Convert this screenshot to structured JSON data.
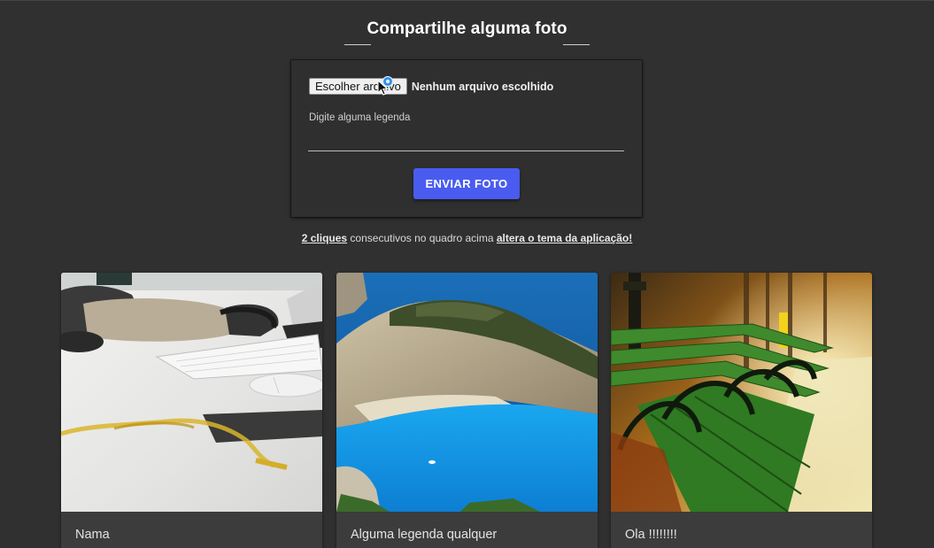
{
  "header": {
    "title": "Compartilhe alguma foto"
  },
  "upload_form": {
    "file_button_label": "Escolher arquivo",
    "file_status": "Nenhum arquivo escolhido",
    "caption_label": "Digite alguma legenda",
    "caption_value": "",
    "send_button_label": "ENVIAR FOTO"
  },
  "hint": {
    "link_clicks": "2 cliques",
    "middle_text": " consecutivos no quadro acima ",
    "link_theme": "altera o tema da aplicação!"
  },
  "photos": [
    {
      "caption": "Nama",
      "image": "desk-keyboard-mouse-photo"
    },
    {
      "caption": "Alguma legenda qualquer",
      "image": "beach-cove-cliff-photo"
    },
    {
      "caption": "Ola !!!!!!!!",
      "image": "park-green-bench-photo"
    }
  ],
  "colors": {
    "background": "#303030",
    "accent_button": "#4a5cf0"
  },
  "icons": {
    "cursor": "mouse-pointer-icon"
  }
}
